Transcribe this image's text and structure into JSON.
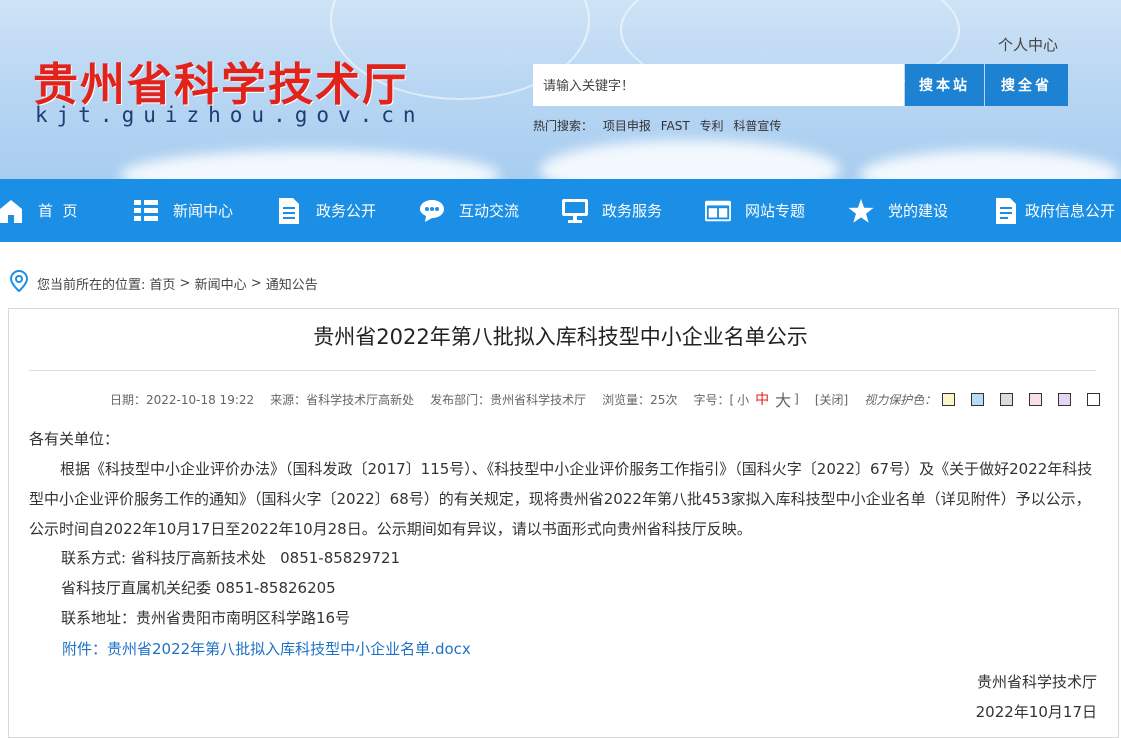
{
  "header": {
    "title": "贵州省科学技术厅",
    "domain": "kjt.guizhou.gov.cn",
    "personal_center": "个人中心",
    "search_placeholder": "请输入关键字！",
    "btn_site": "搜本站",
    "btn_province": "搜全省",
    "hot_label": "热门搜索：",
    "hot_terms": [
      "项目申报",
      "FAST",
      "专利",
      "科普宣传"
    ]
  },
  "nav": [
    {
      "label": "首  页",
      "icon": "home-icon"
    },
    {
      "label": "新闻中心",
      "icon": "news-grid-icon"
    },
    {
      "label": "政务公开",
      "icon": "document-icon"
    },
    {
      "label": "互动交流",
      "icon": "chat-bubble-icon"
    },
    {
      "label": "政务服务",
      "icon": "monitor-icon"
    },
    {
      "label": "网站专题",
      "icon": "topic-window-icon"
    },
    {
      "label": "党的建设",
      "icon": "star-icon"
    },
    {
      "label": "政府信息公开",
      "icon": "info-document-icon"
    }
  ],
  "breadcrumb": {
    "prefix": "您当前所在的位置:",
    "items": [
      "首页",
      "新闻中心",
      "通知公告"
    ],
    "sep": " > "
  },
  "article": {
    "title": "贵州省2022年第八批拟入库科技型中小企业名单公示",
    "meta": {
      "date": "日期：2022-10-18 19:22",
      "source": "来源：省科学技术厅高新处",
      "dept": "发布部门：贵州省科学技术厅",
      "views": "浏览量：25次",
      "font_label": "字号：[",
      "font_small": "小",
      "font_medium": "中",
      "font_large": "大",
      "font_close": "]",
      "close": "[关闭]",
      "eye_label": "视力保护色：",
      "swatches": [
        "#fbf6c8",
        "#b7dcf5",
        "#dcdcdc",
        "#f9dde8",
        "#e6d4f3",
        "#ffffff"
      ]
    },
    "salutation": "各有关单位：",
    "paragraph": "根据《科技型中小企业评价办法》（国科发政〔2017〕115号）、《科技型中小企业评价服务工作指引》（国科火字〔2022〕67号）及《关于做好2022年科技型中小企业评价服务工作的通知》（国科火字〔2022〕68号）的有关规定，现将贵州省2022年第八批453家拟入库科技型中小企业名单（详见附件）予以公示，公示时间自2022年10月17日至2022年10月28日。公示期间如有异议，请以书面形式向贵州省科技厅反映。",
    "contact1": "联系方式: 省科技厅高新技术处   0851-85829721",
    "contact2": "省科技厅直属机关纪委 0851-85826205",
    "address": "联系地址：贵州省贵阳市南明区科学路16号",
    "attachment": "附件：贵州省2022年第八批拟入库科技型中小企业名单.docx",
    "signer": "贵州省科学技术厅",
    "sign_date": "2022年10月17日"
  }
}
